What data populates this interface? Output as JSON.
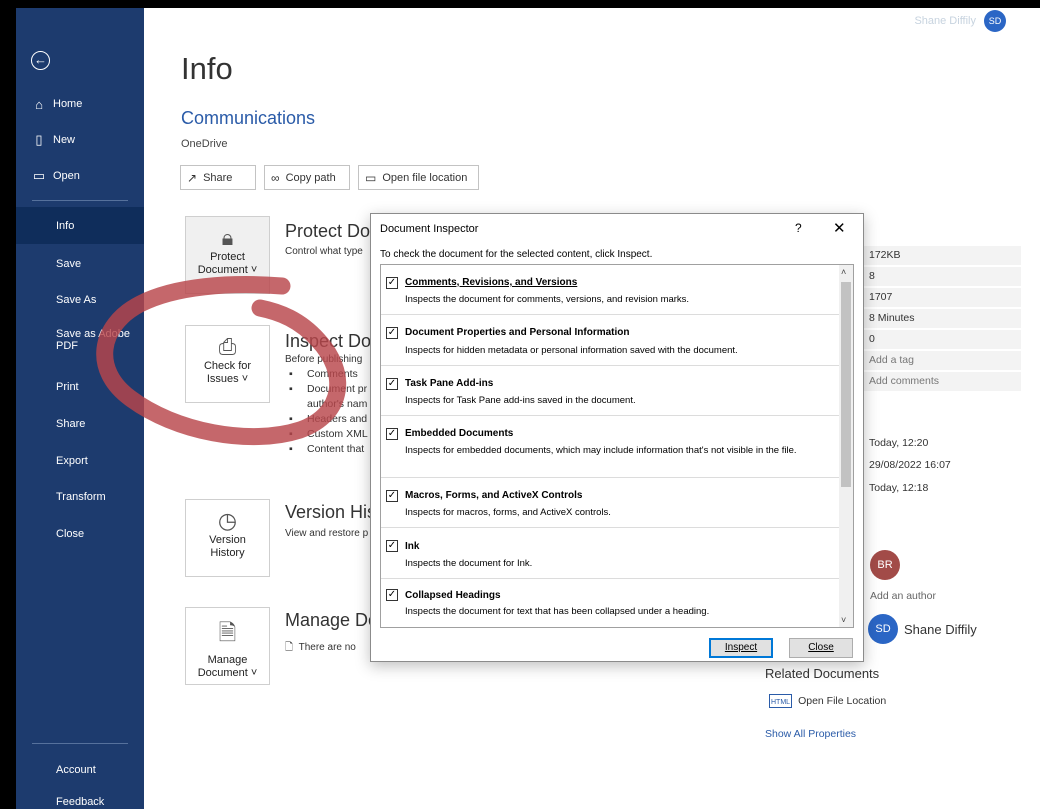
{
  "user": {
    "name": "Shane Diffily",
    "initials": "SD"
  },
  "sidebar": {
    "back_icon": "back-arrow-icon",
    "items": [
      {
        "label": "Home",
        "icon": "home-icon"
      },
      {
        "label": "New",
        "icon": "new-doc-icon"
      },
      {
        "label": "Open",
        "icon": "folder-icon"
      },
      {
        "label": "Info"
      },
      {
        "label": "Save"
      },
      {
        "label": "Save As"
      },
      {
        "label": "Save as Adobe PDF"
      },
      {
        "label": "Print"
      },
      {
        "label": "Share"
      },
      {
        "label": "Export"
      },
      {
        "label": "Transform"
      },
      {
        "label": "Close"
      }
    ],
    "bottom": [
      {
        "label": "Account"
      },
      {
        "label": "Feedback"
      }
    ],
    "active": "Info"
  },
  "main": {
    "title": "Info",
    "doc_title": "Communications",
    "location": "OneDrive",
    "toolbar": {
      "share": "Share",
      "copy_path": "Copy path",
      "open_location": "Open file location"
    },
    "sections": {
      "protect": {
        "btn1": "Protect",
        "btn2": "Document ˅",
        "heading": "Protect Doc",
        "desc": "Control what type"
      },
      "inspect": {
        "btn1": "Check for",
        "btn2": "Issues ˅",
        "heading": "Inspect Doc",
        "desc": "Before publishing",
        "bullets": [
          "Comments",
          "Document pr",
          "author's nam",
          "Headers and",
          "Custom XML",
          "Content that"
        ]
      },
      "version": {
        "btn1": "Version",
        "btn2": "History",
        "heading": "Version Hist",
        "desc": "View and restore p"
      },
      "manage": {
        "btn1": "Manage",
        "btn2": "Document ˅",
        "heading": "Manage Do",
        "desc": "There are no"
      }
    },
    "properties": {
      "size": "172KB",
      "pages": "8",
      "words": "1707",
      "editing_time": "8 Minutes",
      "title_val": "0",
      "tags": "Add a tag",
      "comments": "Add comments",
      "modified": "Today, 12:20",
      "created": "29/08/2022 16:07",
      "printed": "Today, 12:18"
    },
    "people": {
      "br_initials": "BR",
      "add_author": "Add an author",
      "sd_initials": "SD",
      "author_name": "Shane Diffily"
    },
    "related": {
      "heading": "Related Documents",
      "open_location": "Open File Location",
      "show_all": "Show All Properties",
      "html_badge": "HTML"
    }
  },
  "dialog": {
    "title": "Document Inspector",
    "help": "?",
    "close": "✕",
    "intro": "To check the document for the selected content, click Inspect.",
    "items": [
      {
        "title": "Comments, Revisions, and Versions",
        "desc": "Inspects the document for comments, versions, and revision marks.",
        "checked": true
      },
      {
        "title": "Document Properties and Personal Information",
        "desc": "Inspects for hidden metadata or personal information saved with the document.",
        "checked": true
      },
      {
        "title": "Task Pane Add-ins",
        "desc": "Inspects for Task Pane add-ins saved in the document.",
        "checked": true
      },
      {
        "title": "Embedded Documents",
        "desc": "Inspects for embedded documents, which may include information that's not visible in the file.",
        "checked": true
      },
      {
        "title": "Macros, Forms, and ActiveX Controls",
        "desc": "Inspects for macros, forms, and ActiveX controls.",
        "checked": true
      },
      {
        "title": "Ink",
        "desc": "Inspects the document for Ink.",
        "checked": true
      },
      {
        "title": "Collapsed Headings",
        "desc": "Inspects the document for text that has been collapsed under a heading.",
        "checked": true
      }
    ],
    "inspect_label": "Inspect",
    "close_label": "Close"
  }
}
